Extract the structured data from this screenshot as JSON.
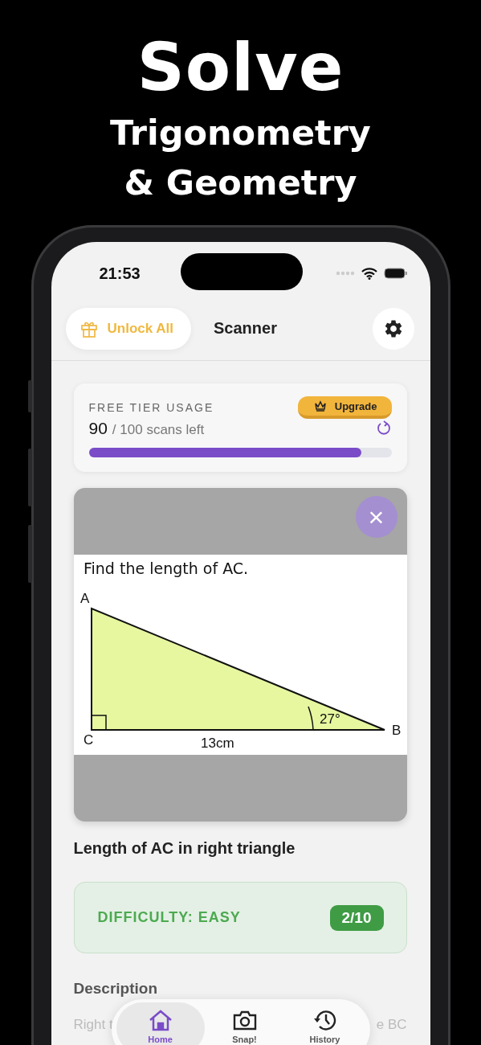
{
  "headline": {
    "title": "Solve",
    "subtitle_lines": [
      "Trigonometry",
      "& Geometry"
    ]
  },
  "status_bar": {
    "time": "21:53"
  },
  "header": {
    "unlock_button": "Unlock All",
    "title": "Scanner"
  },
  "usage": {
    "label": "FREE TIER USAGE",
    "upgrade_button": "Upgrade",
    "count": "90",
    "count_suffix": "/ 100 scans left",
    "level": 0.9
  },
  "problem": {
    "close": "×",
    "question": "Find the length of AC.",
    "vertex_labels": [
      "A",
      "C",
      "B"
    ],
    "side_label": "13cm",
    "angle_label": "27°"
  },
  "result_title": "Length of AC in right triangle",
  "difficulty": {
    "label": "DIFFICULTY: EASY",
    "score": "2/10"
  },
  "description": {
    "heading": "Description",
    "lines": [
      {
        "left": "Right t",
        "right": "e BC"
      }
    ]
  },
  "tabs": [
    {
      "label": "Home",
      "kind": "home",
      "selected": true
    },
    {
      "label": "Snap!",
      "kind": "camera",
      "selected": false
    },
    {
      "label": "History",
      "kind": "history",
      "selected": false
    }
  ]
}
